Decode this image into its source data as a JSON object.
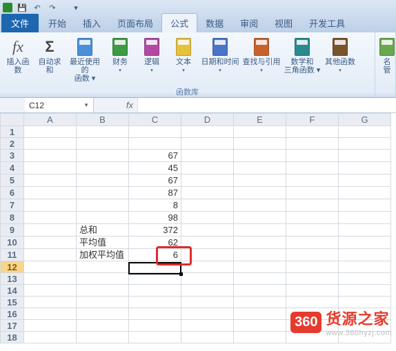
{
  "qat": {
    "save": "💾",
    "undo": "↶",
    "redo": "↷",
    "more": "▾"
  },
  "tabs": {
    "file": "文件",
    "items": [
      "开始",
      "插入",
      "页面布局",
      "公式",
      "数据",
      "审阅",
      "视图",
      "开发工具"
    ],
    "active_index": 3
  },
  "ribbon": {
    "group_label": "函数库",
    "insert_fn_symbol": "fx",
    "insert_fn_label": "插入函数",
    "autosum_symbol": "Σ",
    "autosum_label": "自动求和",
    "recent_label": "最近使用的\n函数 ▾",
    "buttons": [
      {
        "label": "财务",
        "color": "#3d9b43"
      },
      {
        "label": "逻辑",
        "color": "#b24aa5"
      },
      {
        "label": "文本",
        "color": "#e6c23a"
      },
      {
        "label": "日期和时间",
        "color": "#4a74c9"
      },
      {
        "label": "查找与引用",
        "color": "#c9622a"
      },
      {
        "label": "数学和\n三角函数 ▾",
        "color": "#2a8a8f"
      },
      {
        "label": "其他函数",
        "color": "#7a542a"
      }
    ],
    "name_mgr_label": "名\n管"
  },
  "namebox": "C12",
  "fx_symbol": "fx",
  "formula_value": "",
  "columns": [
    "A",
    "B",
    "C",
    "D",
    "E",
    "F",
    "G"
  ],
  "rows": [
    1,
    2,
    3,
    4,
    5,
    6,
    7,
    8,
    9,
    10,
    11,
    12,
    13,
    14,
    15,
    16,
    17,
    18
  ],
  "selected_row": 12,
  "cells": {
    "B9": "总和",
    "B10": "平均值",
    "B11": "加权平均值",
    "C3": "67",
    "C4": "45",
    "C5": "67",
    "C6": "87",
    "C7": "8",
    "C8": "98",
    "C9": "372",
    "C10": "62",
    "C11": "6"
  },
  "watermark": {
    "badge": "360",
    "title": "货源之家",
    "url": "www.360hyzj.com"
  }
}
